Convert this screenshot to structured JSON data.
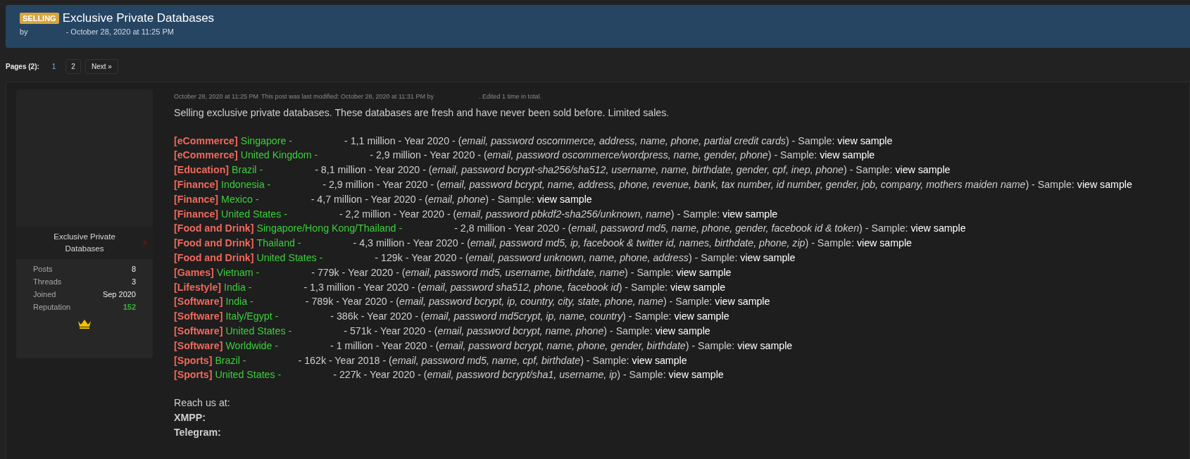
{
  "thread": {
    "prefix": "SELLING",
    "title": "Exclusive Private Databases",
    "by_label": "by",
    "date": "- October 28, 2020 at 11:25 PM"
  },
  "pagination": {
    "label": "Pages (2):",
    "pages": [
      {
        "label": "1",
        "selected": true
      },
      {
        "label": "2",
        "selected": false
      }
    ],
    "next": "Next »"
  },
  "author": {
    "name": "Exclusive Private Databases",
    "online": false,
    "stats": [
      {
        "label": "Posts",
        "value": "8",
        "kind": "plain"
      },
      {
        "label": "Threads",
        "value": "3",
        "kind": "plain"
      },
      {
        "label": "Joined",
        "value": "Sep 2020",
        "kind": "plain"
      },
      {
        "label": "Reputation",
        "value": "152",
        "kind": "positive"
      }
    ]
  },
  "post": {
    "date": "October 28, 2020 at 11:25 PM",
    "modified": "This post was last modified: October 28, 2020 at 11:31 PM by",
    "edited": ". Edited 1 time in total.",
    "intro": "Selling exclusive private databases. These databases are fresh and have never been sold before. Limited sales.",
    "listings": [
      {
        "category": "[eCommerce]",
        "region": "Singapore  -",
        "details": "- 1,1 million - Year 2020 - (*email, password oscommerce, address, name, phone, partial credit cards*) - Sample:",
        "link": "view sample"
      },
      {
        "category": "[eCommerce]",
        "region": "United Kingdom -",
        "details": "- 2,9 million - Year 2020 - (*email, password oscommerce/wordpress, name, gender, phone*) - Sample:",
        "link": "view sample"
      },
      {
        "category": "[Education]",
        "region": "Brazil -",
        "details": "- 8,1 million - Year 2020 - (*email, password bcrypt-sha256/sha512, username, name, birthdate, gender, cpf, inep, phone*) - Sample:",
        "link": "view sample"
      },
      {
        "category": "[Finance]",
        "region": "Indonesia -",
        "details": "- 2,9 million - Year 2020 - (*email, password bcrypt, name, address, phone, revenue, bank, tax number, id number, gender, job, company, mothers maiden name*) - Sample:",
        "link": "view sample"
      },
      {
        "category": "[Finance]",
        "region": "Mexico  -",
        "details": "- 4,7 million - Year 2020 - (*email, phone*) - Sample:",
        "link": "view sample"
      },
      {
        "category": "[Finance]",
        "region": "United States -",
        "details": "- 2,2 million - Year 2020 - (*email, password pbkdf2-sha256/unknown, name*) - Sample:",
        "link": "view sample"
      },
      {
        "category": "[Food and Drink]",
        "region": "Singapore/Hong Kong/Thailand -",
        "details": "- 2,8 million - Year 2020 - (*email, password md5, name, phone, gender, facebook id & token*) - Sample:",
        "link": "view sample"
      },
      {
        "category": "[Food and Drink]",
        "region": "Thailand -",
        "details": "- 4,3 million - Year 2020 - (*email, password md5, ip, facebook & twitter id, names, birthdate, phone, zip*) - Sample:",
        "link": "view sample"
      },
      {
        "category": "[Food and Drink]",
        "region": "United States -",
        "details": "- 129k - Year 2020 - (*email, password unknown, name, phone, address*) - Sample:",
        "link": "view sample"
      },
      {
        "category": "[Games]",
        "region": "Vietnam -",
        "details": "- 779k - Year 2020 - (*email, password md5, username, birthdate, name*) - Sample:",
        "link": "view sample"
      },
      {
        "category": "[Lifestyle]",
        "region": "India -",
        "details": "- 1,3 million - Year 2020 - (*email, password sha512, phone, facebook id*) - Sample:",
        "link": "view sample"
      },
      {
        "category": "[Software]",
        "region": "India -",
        "details": "- 789k - Year 2020 - (*email, password bcrypt, ip, country, city, state, phone, name*) - Sample:",
        "link": "view sample"
      },
      {
        "category": "[Software]",
        "region": "Italy/Egypt -",
        "details": "- 386k - Year 2020 - (*email, password md5crypt, ip, name, country*) - Sample:",
        "link": "view sample"
      },
      {
        "category": "[Software]",
        "region": "United States -",
        "details": "- 571k - Year 2020 - (*email, password bcrypt, name, phone*) - Sample:",
        "link": "view sample"
      },
      {
        "category": "[Software]",
        "region": "Worldwide -",
        "details": "- 1 million - Year 2020 - (*email, password bcrypt, name, phone, gender, birthdate*) - Sample:",
        "link": "view sample"
      },
      {
        "category": "[Sports]",
        "region": "Brazil -",
        "details": "- 162k - Year 2018 - (*email, password md5, name, cpf, birthdate*) - Sample:",
        "link": "view sample"
      },
      {
        "category": "[Sports]",
        "region": "United States  -",
        "details": "- 227k - Year 2020 - (*email, password bcrypt/sha1, username, ip*) - Sample:",
        "link": "view sample"
      }
    ],
    "contact": {
      "intro": "Reach us at:",
      "lines": [
        "XMPP:",
        "Telegram:"
      ]
    }
  }
}
